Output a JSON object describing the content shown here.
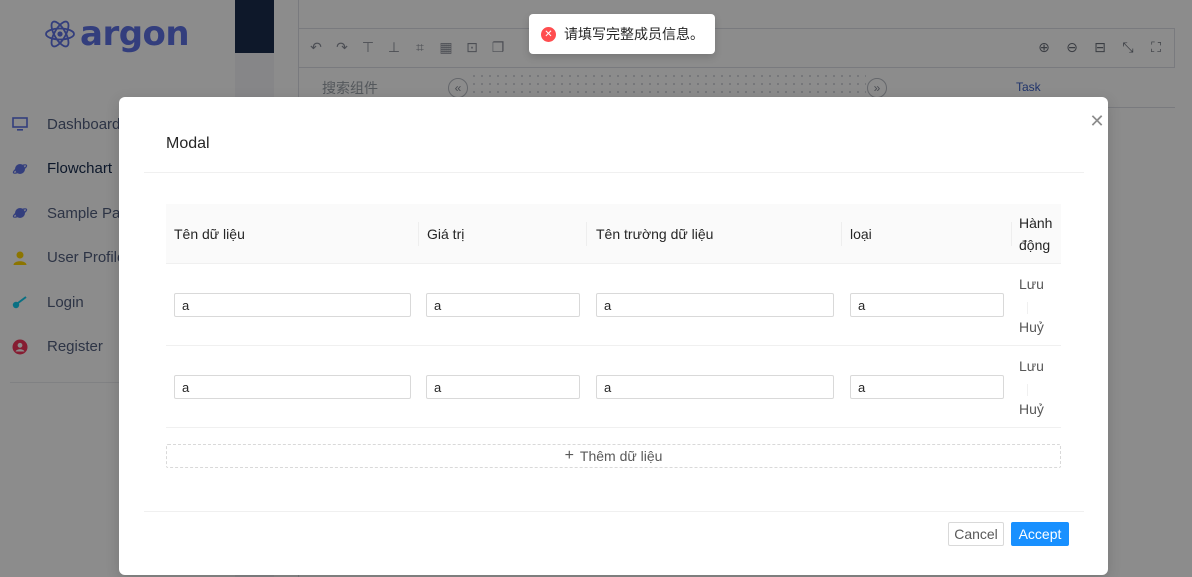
{
  "app": {
    "logo_text": "argon",
    "nav": [
      {
        "label": "Dashboard",
        "icon": "monitor-icon",
        "color": "#5e72e4"
      },
      {
        "label": "Flowchart",
        "icon": "planet-icon",
        "color": "#5e72e4"
      },
      {
        "label": "Sample Page",
        "icon": "planet-icon",
        "color": "#5e72e4"
      },
      {
        "label": "User Profile",
        "icon": "user-icon",
        "color": "#ffd600"
      },
      {
        "label": "Login",
        "icon": "key-icon",
        "color": "#11cdef"
      },
      {
        "label": "Register",
        "icon": "circle-user-icon",
        "color": "#f5365c"
      }
    ],
    "editor": {
      "search_label": "搜索组件",
      "task_label": "Task"
    }
  },
  "toast": {
    "message": "请填写完整成员信息。",
    "icon": "error-icon",
    "color": "#ff4d4f"
  },
  "modal": {
    "title": "Modal",
    "columns": [
      "Tên dữ liệu",
      "Giá trị",
      "Tên trường dữ liệu",
      "loại",
      "Hành động"
    ],
    "rows": [
      {
        "name": "a",
        "value": "a",
        "field": "a",
        "type": "a",
        "save": "Lưu",
        "cancel": "Huỷ"
      },
      {
        "name": "a",
        "value": "a",
        "field": "a",
        "type": "a",
        "save": "Lưu",
        "cancel": "Huỷ"
      }
    ],
    "add_label": "Thêm dữ liệu",
    "cancel_label": "Cancel",
    "accept_label": "Accept",
    "accent_color": "#1890ff"
  }
}
